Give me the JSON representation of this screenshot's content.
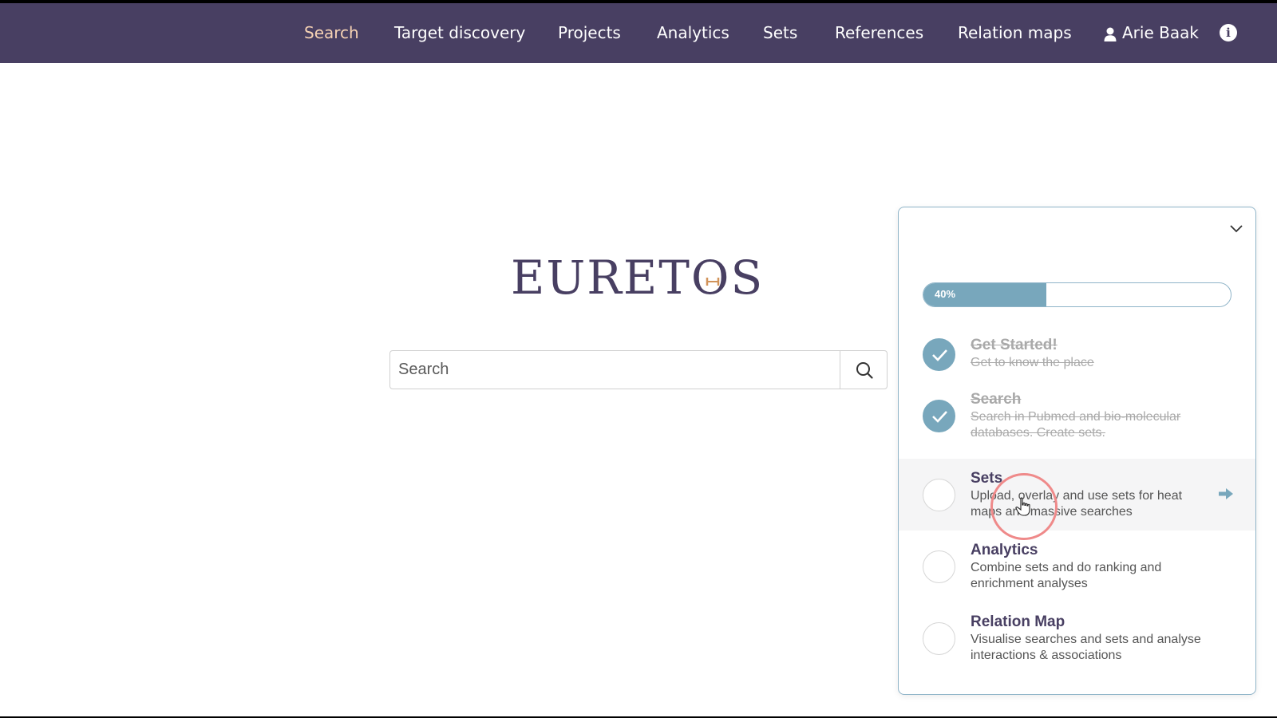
{
  "nav": {
    "items": [
      {
        "label": "Search",
        "active": true
      },
      {
        "label": "Target discovery"
      },
      {
        "label": "Projects"
      },
      {
        "label": "Analytics"
      },
      {
        "label": "Sets"
      },
      {
        "label": "References"
      },
      {
        "label": "Relation maps"
      }
    ],
    "user_name": "Arie Baak",
    "info_icon": "info-icon",
    "user_icon": "user-icon",
    "active_color": "#f6d2b4"
  },
  "logo": {
    "text": "EURETOS"
  },
  "search": {
    "placeholder": "Search",
    "value": "",
    "icon": "search-icon"
  },
  "onboarding": {
    "progress_label": "40%",
    "progress_fraction": 0.4,
    "collapse_icon": "chevron-down-icon",
    "steps": [
      {
        "title": "Get Started!",
        "desc": "Get to know the place",
        "completed": true
      },
      {
        "title": "Search",
        "desc": "Search in Pubmed and bio-molecular databases. Create sets.",
        "completed": true
      },
      {
        "title": "Sets",
        "desc": "Upload, overlay and use sets for heat maps and massive searches",
        "completed": false,
        "current": true
      },
      {
        "title": "Analytics",
        "desc": "Combine sets and do ranking and enrichment analyses",
        "completed": false
      },
      {
        "title": "Relation Map",
        "desc": "Visualise searches and sets and analyse interactions & associations",
        "completed": false
      }
    ]
  },
  "colors": {
    "navbar": "#483f62",
    "accent_teal": "#78a7bc",
    "click_ring": "#ef8a8a"
  }
}
